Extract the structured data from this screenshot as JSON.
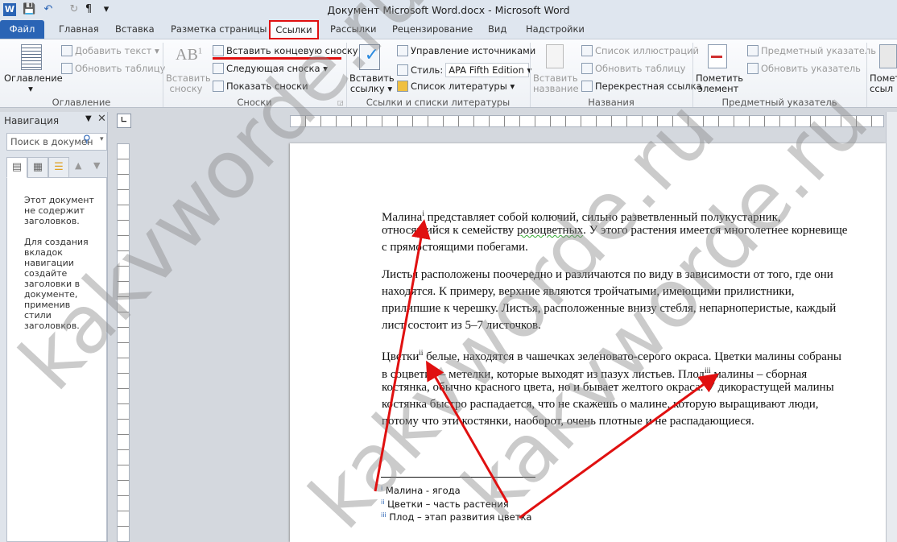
{
  "window": {
    "title": "Документ Microsoft Word.docx  -  Microsoft Word"
  },
  "quick_access": {
    "word": "W",
    "save": "💾",
    "undo": "↶",
    "redo": "↻",
    "para": "¶",
    "customize": "▾"
  },
  "tabs": [
    {
      "label": "Файл"
    },
    {
      "label": "Главная"
    },
    {
      "label": "Вставка"
    },
    {
      "label": "Разметка страницы"
    },
    {
      "label": "Ссылки",
      "active": true
    },
    {
      "label": "Рассылки"
    },
    {
      "label": "Рецензирование"
    },
    {
      "label": "Вид"
    },
    {
      "label": "Надстройки"
    }
  ],
  "ribbon": {
    "toc": {
      "button": "Оглавление",
      "add_text": "Добавить текст",
      "update_table": "Обновить таблицу",
      "group": "Оглавление"
    },
    "footnotes": {
      "insert_footnote_1": "Вставить",
      "insert_footnote_2": "сноску",
      "insert_endnote": "Вставить концевую сноску",
      "next_footnote": "Следующая сноска",
      "show_notes": "Показать сноски",
      "group": "Сноски"
    },
    "citations": {
      "insert_citation_1": "Вставить",
      "insert_citation_2": "ссылку",
      "manage_sources": "Управление источниками",
      "style_label": "Стиль:",
      "style_value": "APA Fifth Edition",
      "bibliography": "Список литературы",
      "group": "Ссылки и списки литературы"
    },
    "captions": {
      "insert_caption_1": "Вставить",
      "insert_caption_2": "название",
      "table_of_figures": "Список иллюстраций",
      "update_table": "Обновить таблицу",
      "cross_reference": "Перекрестная ссылка",
      "group": "Названия"
    },
    "index": {
      "mark_entry_1": "Пометить",
      "mark_entry_2": "элемент",
      "insert_index": "Предметный указатель",
      "update_index": "Обновить указатель",
      "group": "Предметный указатель"
    },
    "toa": {
      "mark_citation_1": "Помет",
      "mark_citation_2": "ссыл"
    }
  },
  "navigation": {
    "title": "Навигация",
    "search_placeholder": "Поиск в докумен",
    "message1": [
      "Этот документ",
      "не содержит",
      "заголовков."
    ],
    "message2": [
      "Для создания",
      "вкладок",
      "навигации",
      "создайте",
      "заголовки в",
      "документе,",
      "применив",
      "стили",
      "заголовков."
    ]
  },
  "document": {
    "p1": {
      "l1a": "Малина",
      "l1sup": "i",
      "l1b": " представляет собой колючий, сильно разветвленный полукустарник,",
      "l2a": "относящийся к семейству ",
      "l2u": "розоцветных",
      "l2b": ". У этого растения имеется многолетнее корневище",
      "l3": "с прямостоящими побегами."
    },
    "p2": [
      "Листья расположены поочередно и различаются по виду в зависимости от того, где они",
      "находятся. К примеру, верхние являются тройчатыми, имеющими прилистники,",
      "прилипшие к черешку. Листья, расположенные внизу стебля, непарноперистые, каждый",
      "лист состоит из 5–7 листочков."
    ],
    "p3": {
      "l1a": "Цветки",
      "l1sup": "ii",
      "l1b": " белые, находятся в чашечках зеленовато-серого окраса. Цветки малины собраны",
      "l2a": "в соцветия – метелки, которые выходят из пазух листьев. Плод",
      "l2sup": "iii",
      "l2b": " малины – сборная",
      "l3": "костянка, обычно красного цвета, но и бывает желтого окраса. У дикорастущей малины",
      "l4": "костянка быстро распадается, что не скажешь о малине, которую выращивают люди,",
      "l5": "потому что эти костянки, наоборот, очень плотные и не распадающиеся."
    },
    "footnotes": [
      {
        "mark": "i",
        "text": "Малина - ягода"
      },
      {
        "mark": "ii",
        "text": "Цветки – часть растения"
      },
      {
        "mark": "iii",
        "text": "Плод – этап развития цветка"
      }
    ]
  },
  "watermark": "kakvworde.ru",
  "colors": {
    "accent": "#2a64b5",
    "annotation": "#e01010"
  }
}
